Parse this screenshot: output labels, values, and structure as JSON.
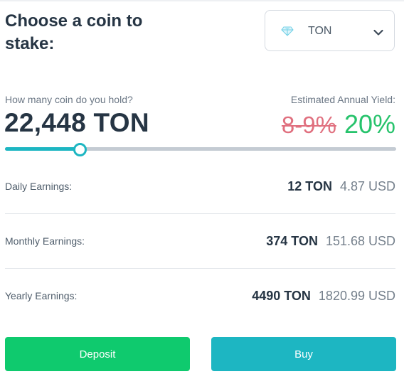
{
  "heading": "Choose a coin to stake:",
  "coin_select": {
    "selected": "TON",
    "icon": "ton-diamond-icon",
    "chevron": "chevron-down-icon"
  },
  "stake": {
    "hold_label": "How many coin do you hold?",
    "amount": "22,448 TON",
    "yield_label": "Estimated Annual Yield:",
    "old_yield": "8-9%",
    "new_yield": "20%",
    "slider_fraction": 0.19
  },
  "earnings": [
    {
      "label": "Daily Earnings:",
      "ton": "12 TON",
      "usd": "4.87 USD"
    },
    {
      "label": "Monthly Earnings:",
      "ton": "374 TON",
      "usd": "151.68 USD"
    },
    {
      "label": "Yearly Earnings:",
      "ton": "4490 TON",
      "usd": "1820.99 USD"
    }
  ],
  "buttons": {
    "deposit": "Deposit",
    "buy": "Buy"
  },
  "colors": {
    "accent": "#1db6c2",
    "deposit": "#0fca6e",
    "yield_new": "#27c36c",
    "yield_old": "#e0707f",
    "text_dark": "#263544"
  }
}
